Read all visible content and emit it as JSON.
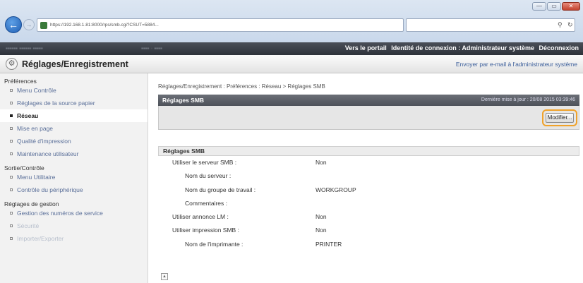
{
  "browser": {
    "address_url": "https://192.168.1.81:8000/rps/smb.cgi?CSUT=5884...",
    "search_icon": "search-icon",
    "refresh_icon": "refresh-icon",
    "window_controls": {
      "minimize": "—",
      "maximize": "▭",
      "close": "✕"
    }
  },
  "topbar": {
    "portal_link": "Vers le portail",
    "login_id_label": "Identité de connexion : Administrateur système",
    "logout_link": "Déconnexion"
  },
  "header": {
    "title": "Réglages/Enregistrement",
    "email_link": "Envoyer par e-mail à l'administrateur système"
  },
  "sidebar": {
    "sections": [
      {
        "label": "Préférences",
        "items": [
          {
            "label": "Menu Contrôle",
            "state": "normal"
          },
          {
            "label": "Réglages de la source papier",
            "state": "normal"
          },
          {
            "label": "Réseau",
            "state": "active"
          },
          {
            "label": "Mise en page",
            "state": "normal"
          },
          {
            "label": "Qualité d'impression",
            "state": "normal"
          },
          {
            "label": "Maintenance utilisateur",
            "state": "normal"
          }
        ]
      },
      {
        "label": "Sortie/Contrôle",
        "items": [
          {
            "label": "Menu Utilitaire",
            "state": "normal"
          },
          {
            "label": "Contrôle du périphérique",
            "state": "normal"
          }
        ]
      },
      {
        "label": "Réglages de gestion",
        "items": [
          {
            "label": "Gestion des numéros de service",
            "state": "normal"
          },
          {
            "label": "Sécurité",
            "state": "faded"
          },
          {
            "label": "Importer/Exporter",
            "state": "faded"
          }
        ]
      }
    ]
  },
  "main": {
    "breadcrumb": "Réglages/Enregistrement : Préférences : Réseau > Réglages SMB",
    "panel_title": "Réglages SMB",
    "last_updated": "Dernière mise à jour : 20/08 2015 03:39:46",
    "modify_button": "Modifier...",
    "section_title": "Réglages SMB",
    "rows": [
      {
        "label": "Utiliser le serveur SMB :",
        "value": "Non",
        "sub": false
      },
      {
        "label": "Nom du serveur :",
        "value": "",
        "sub": true
      },
      {
        "label": "Nom du groupe de travail :",
        "value": "WORKGROUP",
        "sub": true
      },
      {
        "label": "Commentaires :",
        "value": "",
        "sub": true
      },
      {
        "label": "Utiliser annonce LM :",
        "value": "Non",
        "sub": false
      },
      {
        "label": "Utiliser impression SMB :",
        "value": "Non",
        "sub": false
      },
      {
        "label": "Nom de l'imprimante :",
        "value": "PRINTER",
        "sub": true
      }
    ]
  },
  "colors": {
    "accent_highlight": "#f0a22a",
    "topbar_bg": "#3a3e46",
    "link": "#5a6f99"
  }
}
